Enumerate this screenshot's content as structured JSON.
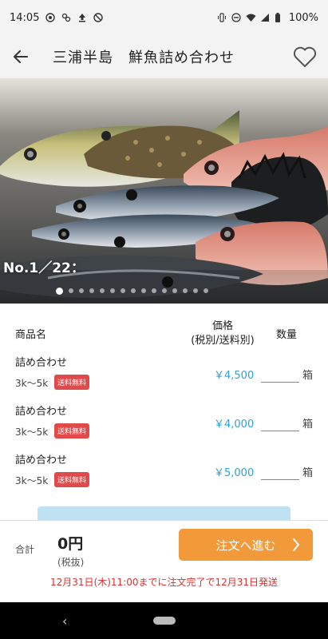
{
  "status_bar": {
    "time": "14:05",
    "battery": "100%",
    "icons_left": [
      "chrome-icon",
      "sync-icon",
      "upload-icon",
      "dnd-icon"
    ],
    "icons_right": [
      "vibrate-icon",
      "minus-circle-icon",
      "wifi-icon",
      "signal-icon",
      "battery-icon"
    ]
  },
  "header": {
    "title": "三浦半島　鮮魚詰め合わせ"
  },
  "gallery": {
    "counter": "No.1／22：",
    "dot_count": 15,
    "active_index": 0
  },
  "table": {
    "col_name": "商品名",
    "col_price_line1": "価格",
    "col_price_line2": "(税別/送料別)",
    "col_qty": "数量",
    "rows": [
      {
        "name": "詰め合わせ",
        "size": "3k～5k",
        "badge": "送料無料",
        "price": "￥4,500",
        "qty": "",
        "unit": "箱"
      },
      {
        "name": "詰め合わせ",
        "size": "3k～5k",
        "badge": "送料無料",
        "price": "￥4,000",
        "qty": "",
        "unit": "箱"
      },
      {
        "name": "詰め合わせ",
        "size": "3k～5k",
        "badge": "送料無料",
        "price": "￥5,000",
        "qty": "",
        "unit": "箱"
      }
    ]
  },
  "footer": {
    "total_label": "合計",
    "total_value": "0円",
    "tax_note": "(税抜)",
    "order_button": "注文へ進む",
    "deadline": "12月31日(木)11:00までに注文完了で12月31日発送"
  },
  "colors": {
    "accent_orange": "#f29a3a",
    "price_blue": "#2aa1d8",
    "badge_red": "#e04a4a",
    "deadline_red": "#e03030"
  }
}
